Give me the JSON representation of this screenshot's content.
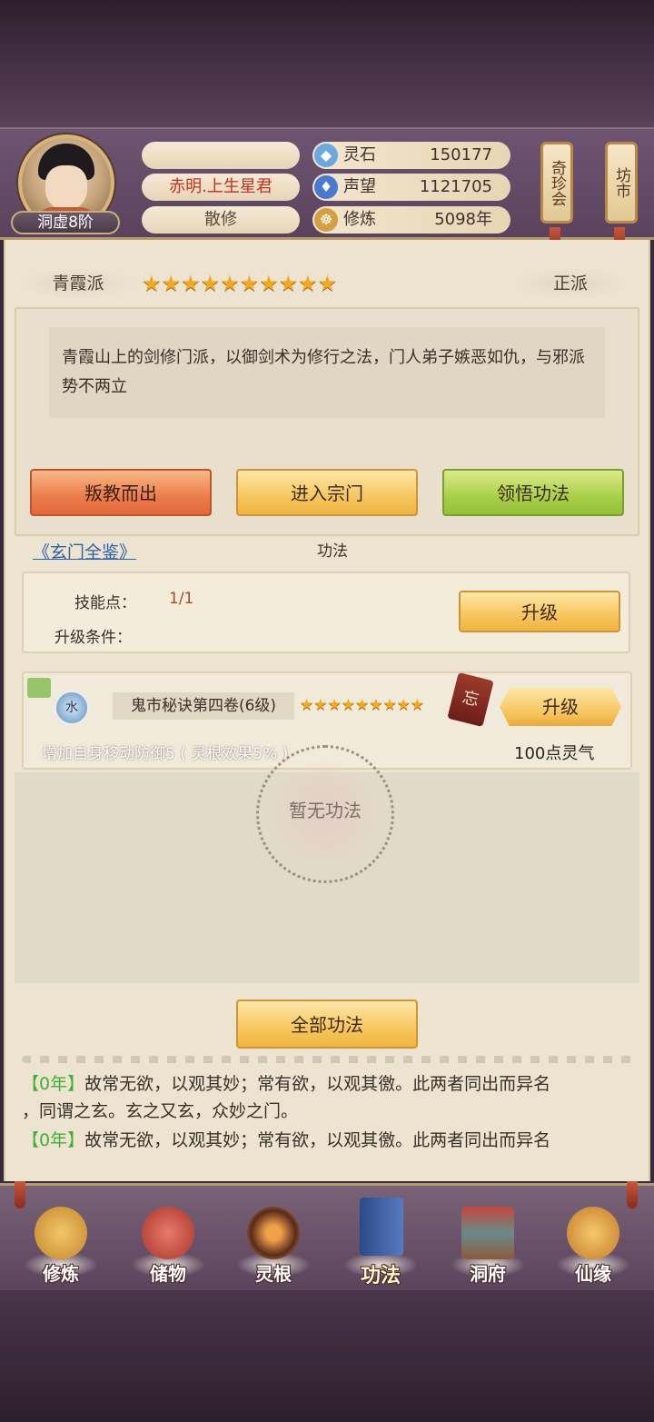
{
  "player": {
    "rank": "洞虚8阶",
    "name_top": "",
    "title": "赤明.上生星君",
    "faction_type": "散修"
  },
  "stats": [
    {
      "icon": "spirit-stone-icon",
      "label": "灵石",
      "value": "150177"
    },
    {
      "icon": "reputation-icon",
      "label": "声望",
      "value": "1121705"
    },
    {
      "icon": "cultivation-icon",
      "label": "修炼",
      "value": "5098年"
    }
  ],
  "side_buttons": {
    "treasure": "奇珍会",
    "market": "坊市"
  },
  "sect": {
    "name": "青霞派",
    "stars": "★★★★★★★★★★",
    "alignment": "正派",
    "description": "青霞山上的剑修门派，以御剑术为修行之法，门人弟子嫉恶如仇，与邪派势不两立"
  },
  "actions": {
    "betray": "叛教而出",
    "enter": "进入宗门",
    "comprehend": "领悟功法"
  },
  "book_link": "《玄门全鉴》",
  "gongfa_title": "功法",
  "skill_points": {
    "label": "技能点：",
    "value": "1/1",
    "cond_label": "升级条件：",
    "upgrade": "升级"
  },
  "item": {
    "element": "水",
    "name": "鬼市秘诀第四卷(6级)",
    "stars": "★★★★★★★★★",
    "forget": "忘",
    "upgrade": "升级",
    "effect": "增加自身移动防御5 ( 灵根效果5% )",
    "cost": "100点灵气"
  },
  "empty_text": "暂无功法",
  "all_gongfa": "全部功法",
  "log": [
    {
      "tag": "【0年】",
      "text": "故常无欲，以观其妙；常有欲，以观其徼。此两者同出而异名"
    },
    {
      "tag": "",
      "text": "，同谓之玄。玄之又玄，众妙之门。"
    },
    {
      "tag": "【0年】",
      "text": "故常无欲，以观其妙；常有欲，以观其徼。此两者同出而异名"
    }
  ],
  "nav": [
    {
      "label": "修炼",
      "icon": "meditation-icon",
      "color": "#d8962e"
    },
    {
      "label": "储物",
      "icon": "bag-icon",
      "color": "#c4483a"
    },
    {
      "label": "灵根",
      "icon": "spirit-root-icon",
      "color": "#b8502a"
    },
    {
      "label": "功法",
      "icon": "book-icon",
      "color": "#3a5a9a"
    },
    {
      "label": "洞府",
      "icon": "cave-house-icon",
      "color": "#8a5a3a"
    },
    {
      "label": "仙缘",
      "icon": "gourd-icon",
      "color": "#d88a2a"
    }
  ]
}
